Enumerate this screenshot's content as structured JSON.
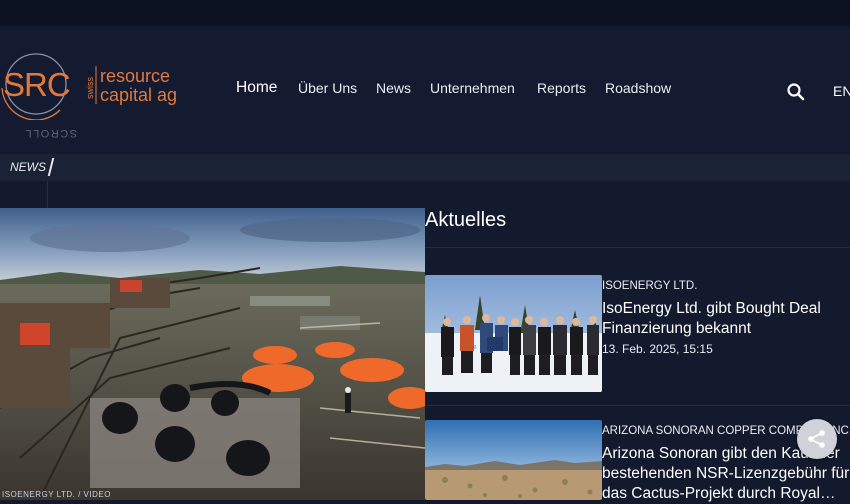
{
  "logo": {
    "letters": "SRC",
    "vertical_text": "swiss",
    "line1": "resource",
    "line2": "capital ag",
    "accent_color": "#e2793b"
  },
  "nav": {
    "items": [
      {
        "label": "Home",
        "active": true
      },
      {
        "label": "Über Uns"
      },
      {
        "label": "News"
      },
      {
        "label": "Unternehmen"
      },
      {
        "label": "Reports"
      },
      {
        "label": "Roadshow"
      }
    ],
    "search_icon": "search-icon",
    "lang": "EN"
  },
  "scroll_label": "SCROLL",
  "breadcrumb": {
    "current": "NEWS"
  },
  "hero": {
    "caption": "ISOENERGY LTD. / VIDEO"
  },
  "section": {
    "title": "Aktuelles"
  },
  "articles": [
    {
      "category": "ISOENERGY LTD.",
      "title": "IsoEnergy Ltd. gibt Bought Deal Finanzierung bekannt",
      "date": "13. Feb. 2025, 15:15"
    },
    {
      "category": "ARIZONA SONORAN COPPER COMPANY INC.",
      "title": "Arizona Sonoran gibt den Kauf der bestehenden NSR-Lizenzgebühr für das Cactus-Projekt durch Royal…",
      "date": ""
    }
  ],
  "share": {
    "icon": "share-icon"
  },
  "colors": {
    "background": "#131a2e",
    "header": "#141b30",
    "accent": "#e2793b"
  }
}
